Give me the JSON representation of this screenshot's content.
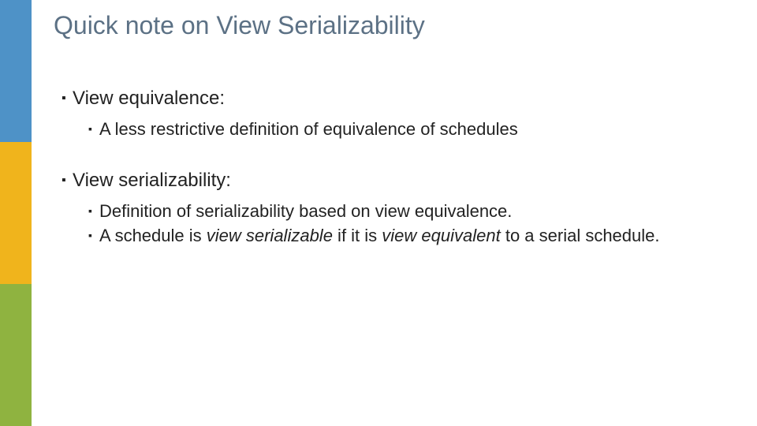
{
  "title": "Quick note on View Serializability",
  "sections": [
    {
      "heading": "View equivalence:",
      "items": [
        {
          "text": "A less restrictive definition of equivalence of schedules"
        }
      ]
    },
    {
      "heading": "View serializability:",
      "items": [
        {
          "text": "Definition of serializability based on view equivalence."
        },
        {
          "prefix": "A schedule is ",
          "em1": "view serializable",
          "mid": " if it is ",
          "em2": "view equivalent",
          "suffix": " to a serial schedule."
        }
      ]
    }
  ]
}
